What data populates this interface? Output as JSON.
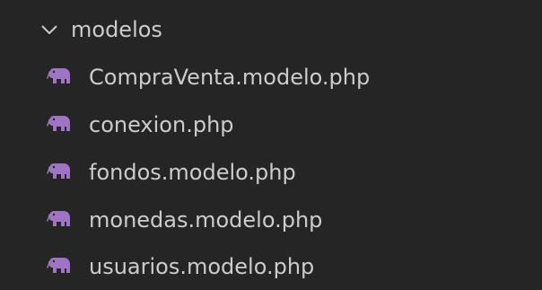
{
  "explorer": {
    "folder": {
      "name": "modelos",
      "expanded": true,
      "icon": "chevron-down-icon"
    },
    "files": [
      {
        "name": "CompraVenta.modelo.php",
        "icon": "php-elephant-icon"
      },
      {
        "name": "conexion.php",
        "icon": "php-elephant-icon"
      },
      {
        "name": "fondos.modelo.php",
        "icon": "php-elephant-icon"
      },
      {
        "name": "monedas.modelo.php",
        "icon": "php-elephant-icon"
      },
      {
        "name": "usuarios.modelo.php",
        "icon": "php-elephant-icon"
      }
    ],
    "colors": {
      "background": "#252526",
      "text": "#cccccc",
      "php_icon": "#a074c4"
    }
  }
}
